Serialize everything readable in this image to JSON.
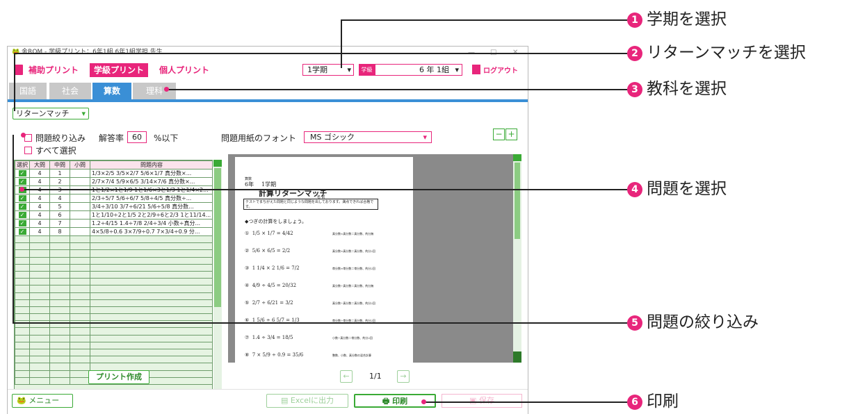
{
  "window": {
    "title": "金ROM - 学級プリント：6年1組 6年1組学担 先生",
    "minimize": "—",
    "maximize": "□",
    "close": "✕"
  },
  "modes": {
    "hojo": "補助プリント",
    "gakkyu": "学級プリント",
    "kojin": "個人プリント"
  },
  "term_select": {
    "value": "1学期"
  },
  "class_select": {
    "tag": "学級",
    "value": "6 年 1組"
  },
  "logout_label": "ログアウト",
  "tabs": [
    {
      "label": "国語"
    },
    {
      "label": "社会"
    },
    {
      "label": "算数"
    },
    {
      "label": "理科"
    }
  ],
  "type_select": {
    "value": "リターンマッチ"
  },
  "filter": {
    "label": "問題絞り込み",
    "rate_label": "解答率",
    "rate_value": "60",
    "suffix": "%以下",
    "select_all": "すべて選択"
  },
  "font_select": {
    "label": "問題用紙のフォント",
    "value": "MS ゴシック"
  },
  "zoom_out": "−",
  "zoom_in": "+",
  "table": {
    "headers": [
      "選択",
      "大問",
      "中問",
      "小問",
      "問題内容"
    ],
    "rows": [
      {
        "dai": "4",
        "chu": "1",
        "content": "1/3×2/5 3/5×2/7 5/6×1/7 真分数×..."
      },
      {
        "dai": "4",
        "chu": "2",
        "content": "2/7×7/4 5/9×6/5 3/14×7/6 真分数×..."
      },
      {
        "dai": "4",
        "chu": "3",
        "content": "1と1/2×1と1/9 1と1/6×3と1/3 1と1/4×2..."
      },
      {
        "dai": "4",
        "chu": "4",
        "content": "2/3÷5/7 5/6÷6/7 5/8÷4/5 真分数÷..."
      },
      {
        "dai": "4",
        "chu": "5",
        "content": "3/4÷3/10 3/7÷6/21 5/6÷5/8 真分数..."
      },
      {
        "dai": "4",
        "chu": "6",
        "content": "1と1/10÷2と1/5 2と2/9÷6と2/3 1と11/14..."
      },
      {
        "dai": "4",
        "chu": "7",
        "content": "1.2÷4/15 1.4÷7/8 2/4÷3/4 小数÷真分..."
      },
      {
        "dai": "4",
        "chu": "8",
        "content": "4×5/8÷0.6 3×7/9÷0.7 7×3/4÷0.9 分..."
      }
    ]
  },
  "paper": {
    "header_small": "算数",
    "grade": "6年",
    "term": "1学期",
    "title": "計算リターンマッチ",
    "name_line": "名 前",
    "notice": "テストでまちがえた問題と同じような問題を出しております。満点できれば合格です。",
    "instruction": "◆つぎの計算をしましょう。",
    "problems": [
      {
        "num": "①",
        "expr": "1/5 × 1/7 = 4/42",
        "note": "真分数×真分数＝真分数、約分無"
      },
      {
        "num": "②",
        "expr": "5/6 × 6/5 = 2/2",
        "note": "真分数×真分数＝真分数、約分2回"
      },
      {
        "num": "③",
        "expr": "1 1/4 × 2 1/6 = 7/2",
        "note": "帯分数×帯分数＝帯分数、約分2回"
      },
      {
        "num": "④",
        "expr": "4/9 ÷ 4/5 = 20/32",
        "note": "真分数÷真分数＝真分数、約分無"
      },
      {
        "num": "⑤",
        "expr": "2/7 ÷ 6/21 = 3/2",
        "note": "真分数÷真分数＝真分数、約分2回"
      },
      {
        "num": "⑥",
        "expr": "1 5/6 ÷ 6 5/7 = 1/3",
        "note": "帯分数÷帯分数＝真分数、約分2回"
      },
      {
        "num": "⑦",
        "expr": "1.4 ÷ 3/4 = 18/5",
        "note": "小数÷真分数＝帯分数、約分2回"
      },
      {
        "num": "⑧",
        "expr": "7 × 5/9 ÷ 0.9 = 35/6",
        "note": "整数、小数、真分数の混合計算"
      }
    ]
  },
  "pager": {
    "prev": "←",
    "page": "1/1",
    "next": "→"
  },
  "create_print": "プリント作成",
  "menu": "メニュー",
  "excel": "Excelに出力",
  "print": "印刷",
  "save": "保存",
  "callouts": [
    {
      "num": "1",
      "label": "学期を選択"
    },
    {
      "num": "2",
      "label": "リターンマッチを選択"
    },
    {
      "num": "3",
      "label": "教科を選択"
    },
    {
      "num": "4",
      "label": "問題を選択"
    },
    {
      "num": "5",
      "label": "問題の絞り込み"
    },
    {
      "num": "6",
      "label": "印刷"
    }
  ],
  "colors": {
    "accent": "#e8257b",
    "green": "#3aaa35",
    "blue": "#3a8fd6"
  }
}
